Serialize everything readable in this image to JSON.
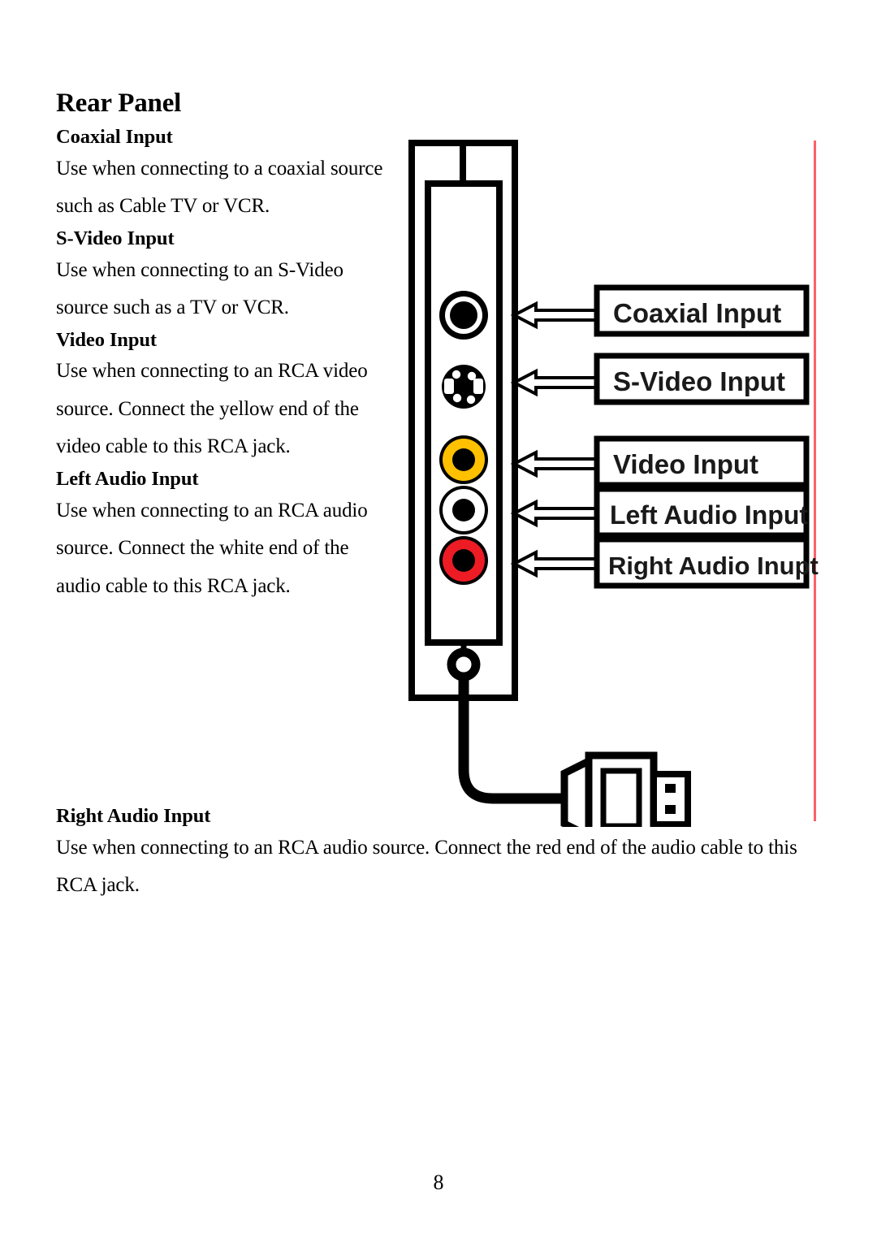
{
  "document": {
    "page_title": "Rear Panel",
    "page_number": "8"
  },
  "sections": [
    {
      "heading": "Coaxial Input",
      "body": "Use when connecting to a coaxial source such as Cable TV or VCR."
    },
    {
      "heading": "S-Video Input",
      "body": "Use when connecting to an S-Video source such as a TV or VCR."
    },
    {
      "heading": "Video Input",
      "body": "Use when connecting to an RCA video source. Connect the yellow end of the video cable to this RCA jack."
    },
    {
      "heading": "Left Audio Input",
      "body": "Use when connecting to an RCA audio source. Connect the white end of the audio cable to this RCA jack."
    },
    {
      "heading": "Right Audio Input",
      "body": "Use when connecting to an RCA audio source. Connect the red end of the audio cable to this RCA jack."
    }
  ],
  "diagram": {
    "name": "rear-panel-connector-diagram",
    "callouts": [
      {
        "label": "Coaxial Input",
        "jack": "coaxial-jack",
        "color": "#000000"
      },
      {
        "label": "S-Video Input",
        "jack": "s-video-jack",
        "color": "#000000"
      },
      {
        "label": "Video Input",
        "jack": "video-rca-jack",
        "color": "#FFC000"
      },
      {
        "label": "Left Audio Input",
        "jack": "left-audio-jack",
        "color": "#FFFFFF"
      },
      {
        "label": "Right Audio Inupt",
        "jack": "right-audio-jack",
        "color": "#ED1C24"
      }
    ],
    "cable_plug": "usb-style-plug",
    "rule_color": "#F9626B"
  }
}
